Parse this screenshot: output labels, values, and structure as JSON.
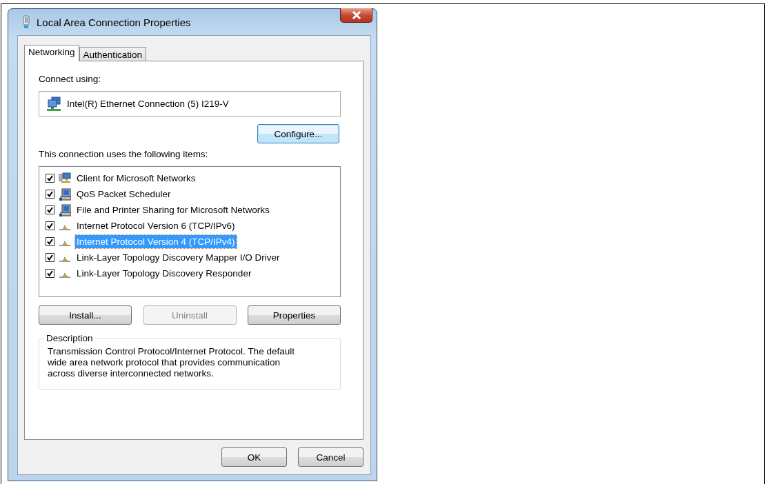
{
  "window": {
    "title": "Local Area Connection Properties"
  },
  "tabs": [
    {
      "label": "Networking",
      "selected": true
    },
    {
      "label": "Authentication",
      "selected": false
    }
  ],
  "connect_using": {
    "label": "Connect using:",
    "adapter": "Intel(R) Ethernet Connection (5) I219-V"
  },
  "configure_button": {
    "label": "Configure..."
  },
  "items_label": "This connection uses the following items:",
  "items": [
    {
      "kind": "client",
      "label": "Client for Microsoft Networks",
      "checked": true,
      "selected": false
    },
    {
      "kind": "service",
      "label": "QoS Packet Scheduler",
      "checked": true,
      "selected": false
    },
    {
      "kind": "service",
      "label": "File and Printer Sharing for Microsoft Networks",
      "checked": true,
      "selected": false
    },
    {
      "kind": "protocol",
      "label": "Internet Protocol Version 6 (TCP/IPv6)",
      "checked": true,
      "selected": false
    },
    {
      "kind": "protocol",
      "label": "Internet Protocol Version 4 (TCP/IPv4)",
      "checked": true,
      "selected": true
    },
    {
      "kind": "protocol",
      "label": "Link-Layer Topology Discovery Mapper I/O Driver",
      "checked": true,
      "selected": false
    },
    {
      "kind": "protocol",
      "label": "Link-Layer Topology Discovery Responder",
      "checked": true,
      "selected": false
    }
  ],
  "item_buttons": [
    {
      "label": "Install...",
      "disabled": false
    },
    {
      "label": "Uninstall",
      "disabled": true
    },
    {
      "label": "Properties",
      "disabled": false
    }
  ],
  "description": {
    "title": "Description",
    "text": "Transmission Control Protocol/Internet Protocol. The default wide area network protocol that provides communication across diverse interconnected networks."
  },
  "dialog_buttons": [
    {
      "label": "OK",
      "disabled": false
    },
    {
      "label": "Cancel",
      "disabled": false
    }
  ]
}
